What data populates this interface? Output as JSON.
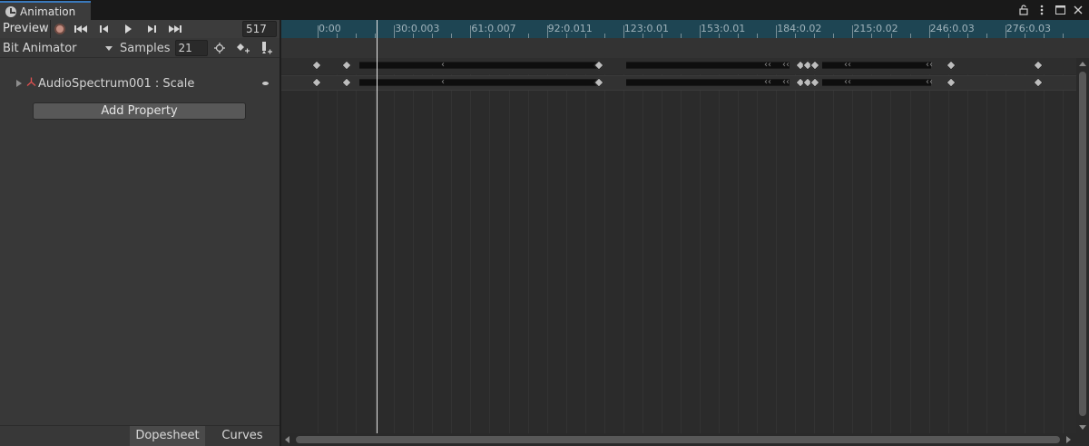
{
  "window": {
    "tab_title": "Animation",
    "icons": [
      "lock-icon",
      "more-icon",
      "maximize-icon",
      "close-icon"
    ]
  },
  "toolbar": {
    "preview_label": "Preview",
    "record_icon": "record-icon",
    "first_key_icon": "first-keyframe-icon",
    "prev_key_icon": "prev-keyframe-icon",
    "play_icon": "play-icon",
    "next_key_icon": "next-keyframe-icon",
    "last_key_icon": "last-keyframe-icon",
    "current_frame": "517"
  },
  "clip_row": {
    "clip_name": "Bit Animator",
    "samples_label": "Samples",
    "samples_value": "21",
    "filter_icon": "filter-selected-icon",
    "add_keyframe_icon": "add-keyframe-icon",
    "add_event_icon": "add-event-icon"
  },
  "property": {
    "label": "AudioSpectrum001 : Scale",
    "icon": "transform-axes-icon"
  },
  "add_property_label": "Add Property",
  "bottom_tabs": {
    "dopesheet": "Dopesheet",
    "curves": "Curves"
  },
  "ruler": {
    "labels": [
      "0:00",
      "30:0.003",
      "61:0.007",
      "92:0.011",
      "123:0.01",
      "153:0.01",
      "184:0.02",
      "215:0.02",
      "246:0.03",
      "276:0.03"
    ]
  },
  "colors": {
    "ruler_bg": "#1e4553",
    "panel_bg": "#383838",
    "accent": "#3a79bb",
    "record": "#c38d80"
  }
}
